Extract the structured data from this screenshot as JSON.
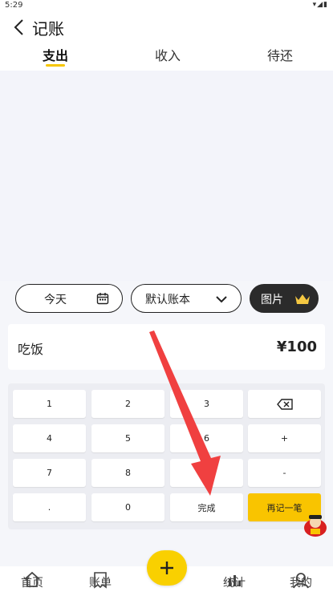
{
  "statusbar": {
    "time": "5:29",
    "icons": "▾◢▮"
  },
  "header": {
    "title": "记账"
  },
  "tabs": [
    {
      "label": "支出",
      "active": true
    },
    {
      "label": "收入",
      "active": false
    },
    {
      "label": "待还",
      "active": false
    }
  ],
  "options": {
    "date_label": "今天",
    "book_label": "默认账本",
    "photo_label": "图片"
  },
  "entry": {
    "note": "吃饭",
    "amount": "¥100"
  },
  "keypad": {
    "keys": [
      "1",
      "2",
      "3",
      "4",
      "5",
      "6",
      "+",
      "7",
      "8",
      "-",
      ".",
      "0",
      "完成",
      "再记一笔"
    ]
  },
  "bottom_nav": {
    "items": [
      {
        "label": "首页",
        "icon": "home-icon"
      },
      {
        "label": "账单",
        "icon": "bill-icon"
      },
      {
        "label": "统计",
        "icon": "stats-icon"
      },
      {
        "label": "我的",
        "icon": "profile-icon"
      }
    ],
    "fab_icon": "plus-icon"
  },
  "colors": {
    "accent": "#f9c400",
    "dark_chip": "#2b2b2b",
    "arrow": "#f04040"
  }
}
